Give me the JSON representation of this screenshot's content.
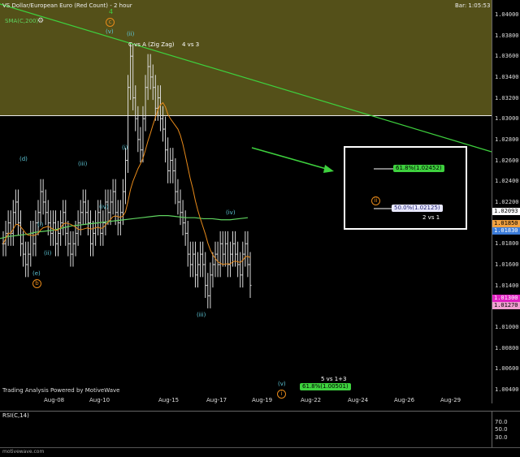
{
  "header": {
    "title": "VS Dollar/European Euro (Red Count) - 2 hour",
    "bar_time": "Bar: 1:05:53"
  },
  "indicators": {
    "sma": "SMA(C,200)",
    "rsi": "RSI(C,14)"
  },
  "annotations": {
    "c_vs_a": "C vs A (Zig Zag)",
    "four_vs_three": "4 vs 3",
    "two_vs_one": "2 vs 1",
    "five_vs_one_three": "5 vs 1+3"
  },
  "wave_labels": {
    "four": "4",
    "c": "c",
    "v_top": "(v)",
    "ii": "(ii)",
    "i": "(i)",
    "iii_left": "(iii)",
    "iv": "(iv)",
    "d": "(d)",
    "i_left": "(i)",
    "ii_left": "(ii)",
    "e": "(e)",
    "b": "b",
    "iii_bottom": "(iii)",
    "iv_right": "(iv)",
    "v_bottom": "(v)",
    "target_ii": "ii",
    "bottom_i": "i"
  },
  "fib_tags": {
    "upper": "61.8%(1.02452)",
    "middle": "50.0%(1.02125)",
    "bottom": "61.8%(1.00501)"
  },
  "price_axis": [
    "1.04000",
    "1.03800",
    "1.03600",
    "1.03400",
    "1.03200",
    "1.03000",
    "1.02800",
    "1.02600",
    "1.02400",
    "1.02200",
    "1.02000",
    "1.01800",
    "1.01600",
    "1.01400",
    "1.01200",
    "1.01000",
    "1.00800",
    "1.00600",
    "1.00400"
  ],
  "price_tags": {
    "current": "1.02093",
    "orange": "1.01850",
    "blue": "1.01830",
    "magenta": "1.01300",
    "pink": "1.01270"
  },
  "x_axis": [
    "Aug-08",
    "Aug-10",
    "Aug-15",
    "Aug-17",
    "Aug-19",
    "Aug-22",
    "Aug-24",
    "Aug-26",
    "Aug-29"
  ],
  "rsi_axis": [
    "70.0",
    "50.0",
    "30.0"
  ],
  "watermark": "Trading Analysis Powered by MotiveWave",
  "footer": "motivewave.com",
  "colors": {
    "olive": "#545019",
    "sma": "#5fd35f",
    "orange": "#e88a1a",
    "cyan": "#5ec8d8",
    "trendline": "#3ed13e"
  },
  "chart_data": {
    "type": "candlestick",
    "title": "VS Dollar/European Euro (Red Count) - 2 hour",
    "y_range": [
      1.004,
      1.041
    ],
    "x_categories": [
      "Aug-08",
      "Aug-10",
      "Aug-15",
      "Aug-17",
      "Aug-19",
      "Aug-22",
      "Aug-24",
      "Aug-26",
      "Aug-29"
    ],
    "close_series": [
      1.018,
      1.019,
      1.02,
      1.019,
      1.021,
      1.022,
      1.02,
      1.018,
      1.017,
      1.016,
      1.017,
      1.019,
      1.018,
      1.02,
      1.021,
      1.023,
      1.022,
      1.021,
      1.02,
      1.019,
      1.02,
      1.018,
      1.019,
      1.02,
      1.021,
      1.019,
      1.018,
      1.017,
      1.018,
      1.019,
      1.02,
      1.021,
      1.022,
      1.021,
      1.02,
      1.018,
      1.019,
      1.02,
      1.021,
      1.019,
      1.02,
      1.022,
      1.021,
      1.022,
      1.023,
      1.021,
      1.02,
      1.021,
      1.023,
      1.026,
      1.033,
      1.036,
      1.032,
      1.03,
      1.028,
      1.027,
      1.03,
      1.033,
      1.035,
      1.034,
      1.033,
      1.031,
      1.032,
      1.03,
      1.029,
      1.027,
      1.025,
      1.026,
      1.025,
      1.023,
      1.022,
      1.021,
      1.02,
      1.019,
      1.017,
      1.016,
      1.017,
      1.015,
      1.016,
      1.017,
      1.016,
      1.014,
      1.013,
      1.015,
      1.016,
      1.017,
      1.016,
      1.018,
      1.017,
      1.018,
      1.016,
      1.017,
      1.018,
      1.017,
      1.016,
      1.015,
      1.017,
      1.018,
      1.016,
      1.014
    ],
    "sma_series": [
      1.0185,
      1.0187,
      1.0188,
      1.0189,
      1.0191,
      1.0192,
      1.0193,
      1.0195,
      1.0197,
      1.0198,
      1.0199,
      1.02,
      1.0201,
      1.0202,
      1.0203,
      1.0204,
      1.0205,
      1.0206,
      1.0207,
      1.0207,
      1.0206,
      1.0205,
      1.0205,
      1.0204,
      1.0204,
      1.0203,
      1.0203,
      1.0204,
      1.0205
    ],
    "rsi_levels": [
      70,
      50,
      30
    ]
  }
}
